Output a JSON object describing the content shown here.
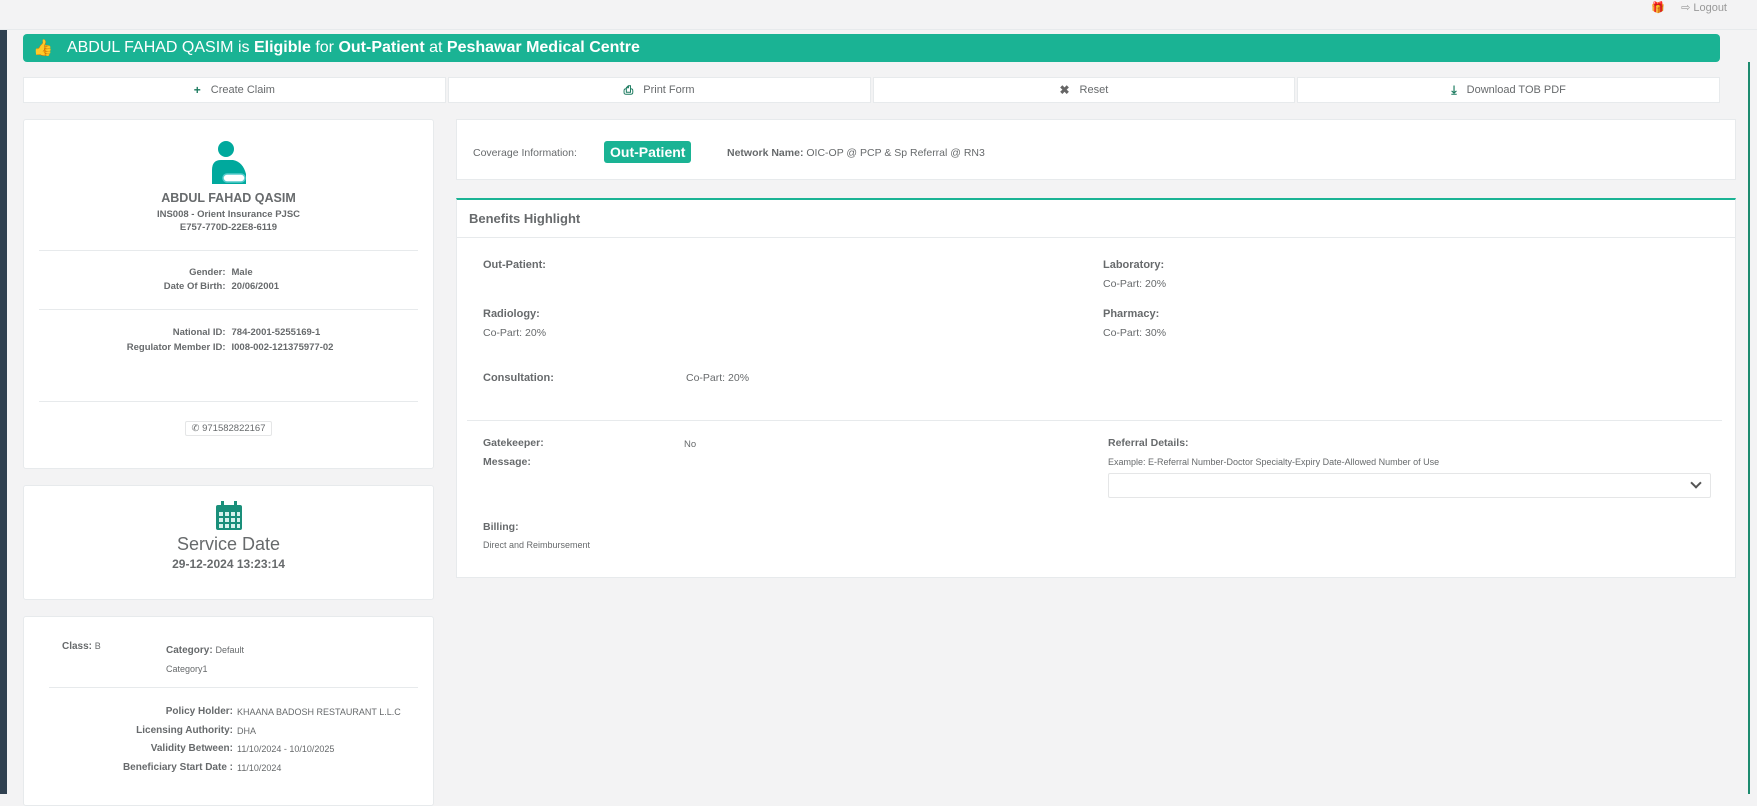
{
  "topbar": {
    "logout": "Logout"
  },
  "banner": {
    "name": "ABDUL FAHAD QASIM",
    "is": "is",
    "status": "Eligible",
    "for": "for",
    "coverage": "Out-Patient",
    "at": "at",
    "provider": "Peshawar Medical Centre"
  },
  "actions": [
    {
      "label": "Create Claim",
      "icon": "+"
    },
    {
      "label": "Print Form",
      "icon": "⎙"
    },
    {
      "label": "Reset",
      "icon": "✖"
    },
    {
      "label": "Download TOB PDF",
      "icon": "⤓"
    }
  ],
  "member": {
    "name": "ABDUL FAHAD QASIM",
    "insurer": "INS008 - Orient Insurance PJSC",
    "card": "E757-770D-22E8-6119",
    "gender_label": "Gender:",
    "gender": "Male",
    "dob_label": "Date Of Birth:",
    "dob": "20/06/2001",
    "nid_label": "National ID:",
    "nid": "784-2001-5255169-1",
    "reg_label": "Regulator Member ID:",
    "reg": "I008-002-121375977-02",
    "phone": "971582822167"
  },
  "service": {
    "title": "Service Date",
    "date": "29-12-2024 13:23:14"
  },
  "policy": {
    "class_label": "Class:",
    "class": "B",
    "category_label": "Category:",
    "category": "Default Category1",
    "holder_label": "Policy Holder:",
    "holder": "KHAANA BADOSH RESTAURANT L.L.C",
    "auth_label": "Licensing Authority:",
    "auth": "DHA",
    "validity_label": "Validity Between:",
    "validity": "11/10/2024 - 10/10/2025",
    "start_label": "Beneficiary Start Date :",
    "start": "11/10/2024"
  },
  "coverage": {
    "label": "Coverage Information:",
    "badge": "Out-Patient",
    "network_label": "Network Name:",
    "network": "OIC-OP @ PCP & Sp Referral @ RN3"
  },
  "benefits": {
    "title": "Benefits Highlight",
    "outpatient": "Out-Patient:",
    "laboratory": "Laboratory:",
    "laboratory_val": "Co-Part: 20%",
    "radiology": "Radiology:",
    "radiology_val": "Co-Part: 20%",
    "pharmacy": "Pharmacy:",
    "pharmacy_val": "Co-Part: 30%",
    "consultation": "Consultation:",
    "consultation_val": "Co-Part: 20%",
    "gatekeeper": "Gatekeeper:",
    "gatekeeper_val": "No",
    "message": "Message:",
    "referral": "Referral Details:",
    "referral_hint": "Example: E-Referral Number-Doctor Specialty-Expiry Date-Allowed Number of Use",
    "billing": "Billing:",
    "billing_val": "Direct and Reimbursement"
  },
  "colors": {
    "accent": "#1ab394",
    "sidebar": "#2f4050"
  }
}
